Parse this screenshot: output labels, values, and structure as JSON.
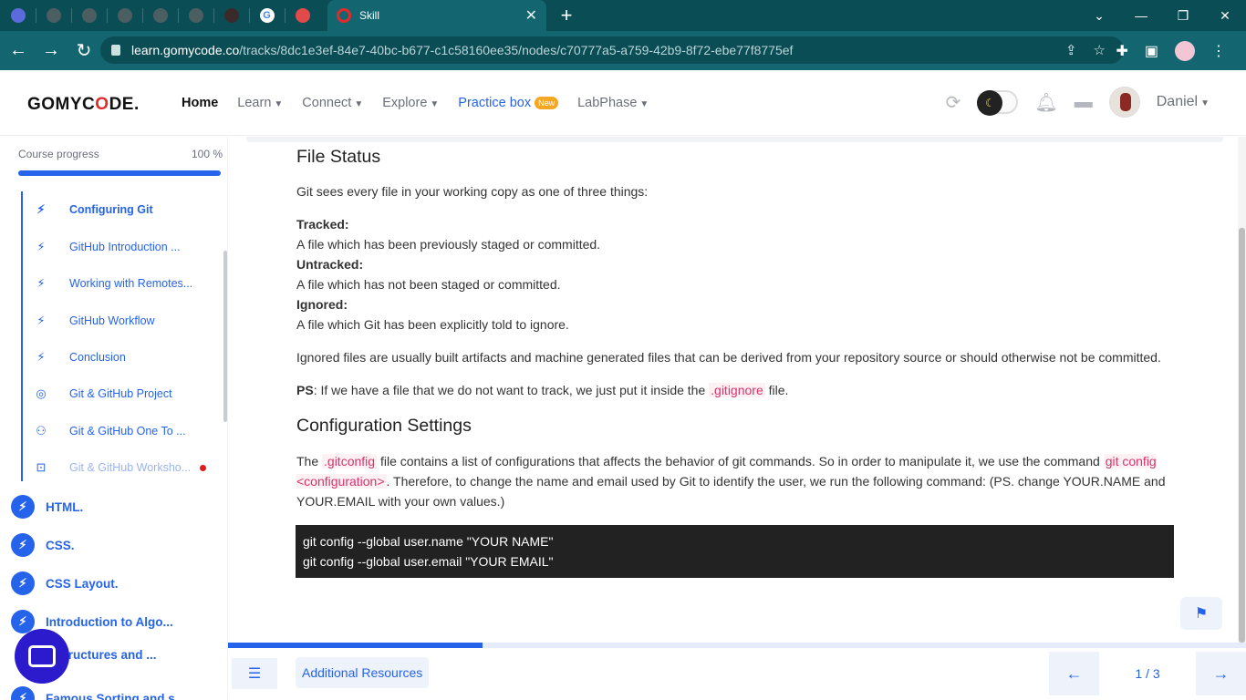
{
  "browser": {
    "active_tab_title": "Skill",
    "url_host": "learn.gomycode.co",
    "url_path": "/tracks/8dc1e3ef-84e7-40bc-b677-c1c58160ee35/nodes/c70777a5-a759-42b9-8f72-ebe77f8775ef",
    "new_tab": "+",
    "win_min": "—",
    "win_max": "❐",
    "win_close": "✕",
    "back": "←",
    "forward": "→",
    "reload": "↻"
  },
  "header": {
    "logo_a": "GOMYC",
    "logo_o": "O",
    "logo_b": "DE",
    "logo_reg": ".",
    "nav": {
      "home": "Home",
      "learn": "Learn",
      "connect": "Connect",
      "explore": "Explore",
      "practice": "Practice box",
      "practice_badge": "New",
      "labphase": "LabPhase"
    },
    "user_name": "Daniel"
  },
  "sidebar": {
    "progress_label": "Course progress",
    "progress_value": "100 %",
    "progress_fraction": 1.0,
    "sub_items": [
      {
        "label": "Configuring Git",
        "icon": "bolt-icon"
      },
      {
        "label": "GitHub Introduction ...",
        "icon": "bolt-icon"
      },
      {
        "label": "Working with Remotes...",
        "icon": "bolt-icon"
      },
      {
        "label": "GitHub Workflow",
        "icon": "bolt-icon"
      },
      {
        "label": "Conclusion",
        "icon": "bolt-icon"
      },
      {
        "label": "Git & GitHub Project",
        "icon": "target-icon"
      },
      {
        "label": "Git & GitHub One To ...",
        "icon": "people-icon"
      },
      {
        "label": "Git & GitHub Worksho...",
        "icon": "workshop-icon"
      }
    ],
    "modules": [
      {
        "label": "HTML."
      },
      {
        "label": "CSS."
      },
      {
        "label": "CSS Layout."
      },
      {
        "label": "Introduction to Algo..."
      },
      {
        "label": "a Structures and ..."
      },
      {
        "label": "Famous Sorting and s..."
      }
    ]
  },
  "content": {
    "h1": "File Status",
    "intro": "Git sees every file in your working copy as one of three things:",
    "tracked_title": "Tracked:",
    "tracked_text": "A file which has been previously staged or committed.",
    "untracked_title": "Untracked:",
    "untracked_text": "A file which has not been staged or committed.",
    "ignored_title": "Ignored:",
    "ignored_text": "A file which Git has been explicitly told to ignore.",
    "ignored_para": "Ignored files are usually built artifacts and machine generated files that can be derived from your repository source or should otherwise not be committed.",
    "ps_label": "PS",
    "ps_text_a": ": If we have a file that we do not want to track, we just put it inside the ",
    "ps_code": ".gitignore",
    "ps_text_b": " file.",
    "h2": "Configuration Settings",
    "cfg_a": "The ",
    "cfg_code1": ".gitconfig",
    "cfg_b": " file contains a list of configurations that affects the behavior of git commands. So in order to manipulate it, we use the command ",
    "cfg_code2": "git config <configuration>",
    "cfg_c": ". Therefore, to change the name and email used by Git to identify the user, we run the following command: (PS. change YOUR.NAME and YOUR.EMAIL with your own values.)",
    "code_line1": "git config --global user.name \"YOUR NAME\"",
    "code_line2": "git config --global user.email \"YOUR EMAIL\""
  },
  "footer": {
    "resources": "Additional Resources",
    "page": "1 / 3",
    "progress_fraction": 0.25
  }
}
